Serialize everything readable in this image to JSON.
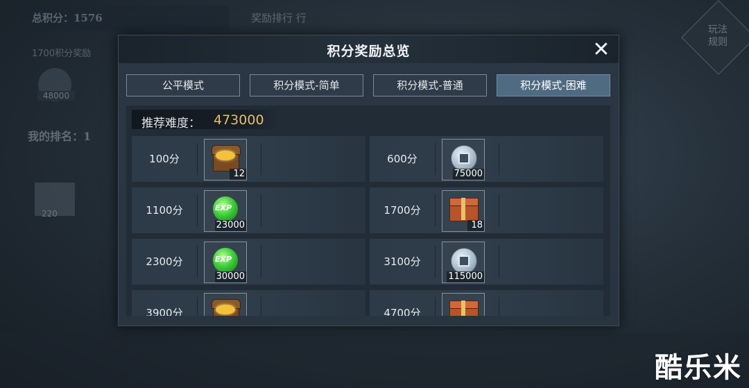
{
  "background": {
    "total_score": "总积分：1576",
    "rank_tab": "奖励排行 行",
    "line1": "1700积分奖励",
    "coin_value": "48000",
    "my_rank": "我的排名：1",
    "card_value": "220",
    "rules_button": "玩法规则"
  },
  "dialog": {
    "title": "积分奖励总览",
    "close_symbol": "✕",
    "tabs": [
      {
        "label": "公平模式",
        "active": false
      },
      {
        "label": "积分模式-简单",
        "active": false
      },
      {
        "label": "积分模式-普通",
        "active": false
      },
      {
        "label": "积分模式-困难",
        "active": true
      }
    ],
    "difficulty_label": "推荐难度：",
    "difficulty_value": "473000",
    "rewards": [
      {
        "points": "100分",
        "item": "gold-chest",
        "qty": "12"
      },
      {
        "points": "600分",
        "item": "silver-coin",
        "qty": "75000"
      },
      {
        "points": "1100分",
        "item": "exp-orb",
        "qty": "23000"
      },
      {
        "points": "1700分",
        "item": "red-chest",
        "qty": "18"
      },
      {
        "points": "2300分",
        "item": "exp-orb",
        "qty": "30000"
      },
      {
        "points": "3100分",
        "item": "silver-coin",
        "qty": "115000"
      },
      {
        "points": "3900分",
        "item": "gold-chest",
        "qty": ""
      },
      {
        "points": "4700分",
        "item": "red-chest",
        "qty": ""
      }
    ]
  },
  "watermark": "酷乐米",
  "colors": {
    "accent_gold": "#e6bf6a",
    "active_tab": "#4f6b82"
  }
}
